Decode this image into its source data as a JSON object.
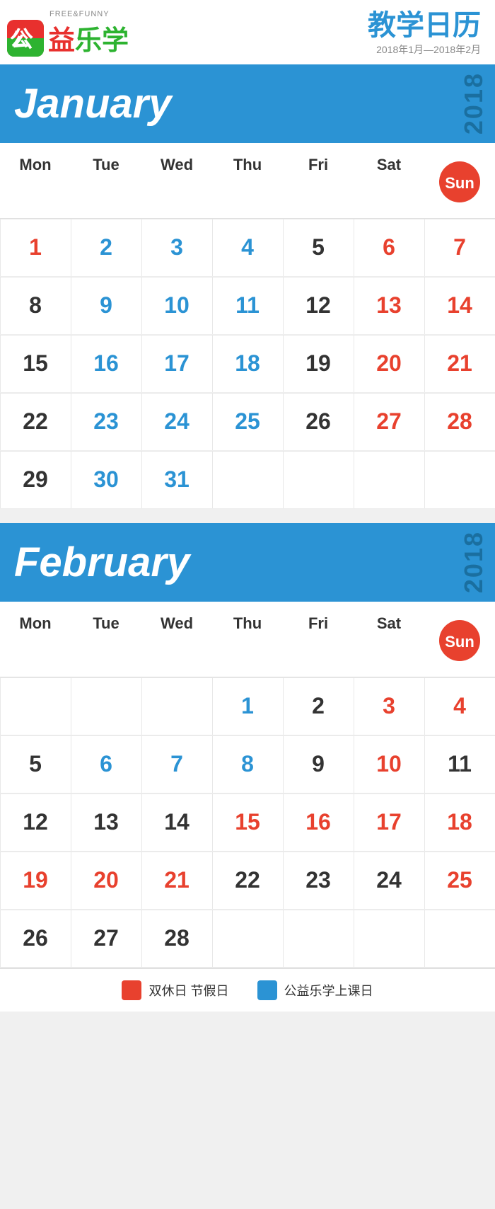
{
  "header": {
    "logo_funny": "FREE&FUNNY",
    "logo_cn": "公益乐学",
    "title_cn": "教学日历",
    "title_date": "2018年1月—2018年2月"
  },
  "day_headers": [
    "Mon",
    "Tue",
    "Wed",
    "Thu",
    "Fri",
    "Sat",
    "Sun"
  ],
  "january": {
    "month_name": "January",
    "year": "2018",
    "weeks": [
      [
        {
          "num": "1",
          "color": "orange"
        },
        {
          "num": "2",
          "color": "blue"
        },
        {
          "num": "3",
          "color": "blue"
        },
        {
          "num": "4",
          "color": "blue"
        },
        {
          "num": "5",
          "color": "dark"
        },
        {
          "num": "6",
          "color": "orange"
        },
        {
          "num": "7",
          "color": "orange"
        }
      ],
      [
        {
          "num": "8",
          "color": "dark"
        },
        {
          "num": "9",
          "color": "blue"
        },
        {
          "num": "10",
          "color": "blue"
        },
        {
          "num": "11",
          "color": "blue"
        },
        {
          "num": "12",
          "color": "dark"
        },
        {
          "num": "13",
          "color": "orange"
        },
        {
          "num": "14",
          "color": "orange"
        }
      ],
      [
        {
          "num": "15",
          "color": "dark"
        },
        {
          "num": "16",
          "color": "blue"
        },
        {
          "num": "17",
          "color": "blue"
        },
        {
          "num": "18",
          "color": "blue"
        },
        {
          "num": "19",
          "color": "dark"
        },
        {
          "num": "20",
          "color": "orange"
        },
        {
          "num": "21",
          "color": "orange"
        }
      ],
      [
        {
          "num": "22",
          "color": "dark"
        },
        {
          "num": "23",
          "color": "blue"
        },
        {
          "num": "24",
          "color": "blue"
        },
        {
          "num": "25",
          "color": "blue"
        },
        {
          "num": "26",
          "color": "dark"
        },
        {
          "num": "27",
          "color": "orange"
        },
        {
          "num": "28",
          "color": "orange"
        }
      ],
      [
        {
          "num": "29",
          "color": "dark"
        },
        {
          "num": "30",
          "color": "blue"
        },
        {
          "num": "31",
          "color": "blue"
        },
        {
          "num": "",
          "color": "empty"
        },
        {
          "num": "",
          "color": "empty"
        },
        {
          "num": "",
          "color": "empty"
        },
        {
          "num": "",
          "color": "empty"
        }
      ]
    ]
  },
  "february": {
    "month_name": "February",
    "year": "2018",
    "weeks": [
      [
        {
          "num": "",
          "color": "empty"
        },
        {
          "num": "",
          "color": "empty"
        },
        {
          "num": "",
          "color": "empty"
        },
        {
          "num": "1",
          "color": "blue"
        },
        {
          "num": "2",
          "color": "dark"
        },
        {
          "num": "3",
          "color": "orange"
        },
        {
          "num": "4",
          "color": "orange"
        }
      ],
      [
        {
          "num": "5",
          "color": "dark"
        },
        {
          "num": "6",
          "color": "blue"
        },
        {
          "num": "7",
          "color": "blue"
        },
        {
          "num": "8",
          "color": "blue"
        },
        {
          "num": "9",
          "color": "dark"
        },
        {
          "num": "10",
          "color": "orange"
        },
        {
          "num": "11",
          "color": "dark"
        }
      ],
      [
        {
          "num": "12",
          "color": "dark"
        },
        {
          "num": "13",
          "color": "dark"
        },
        {
          "num": "14",
          "color": "dark"
        },
        {
          "num": "15",
          "color": "orange"
        },
        {
          "num": "16",
          "color": "orange"
        },
        {
          "num": "17",
          "color": "orange"
        },
        {
          "num": "18",
          "color": "orange"
        }
      ],
      [
        {
          "num": "19",
          "color": "orange"
        },
        {
          "num": "20",
          "color": "orange"
        },
        {
          "num": "21",
          "color": "orange"
        },
        {
          "num": "22",
          "color": "dark"
        },
        {
          "num": "23",
          "color": "dark"
        },
        {
          "num": "24",
          "color": "dark"
        },
        {
          "num": "25",
          "color": "orange"
        }
      ],
      [
        {
          "num": "26",
          "color": "dark"
        },
        {
          "num": "27",
          "color": "dark"
        },
        {
          "num": "28",
          "color": "dark"
        },
        {
          "num": "",
          "color": "empty"
        },
        {
          "num": "",
          "color": "empty"
        },
        {
          "num": "",
          "color": "empty"
        },
        {
          "num": "",
          "color": "empty"
        }
      ]
    ]
  },
  "legend": {
    "item1_label": "双休日 节假日",
    "item2_label": "公益乐学上课日"
  }
}
